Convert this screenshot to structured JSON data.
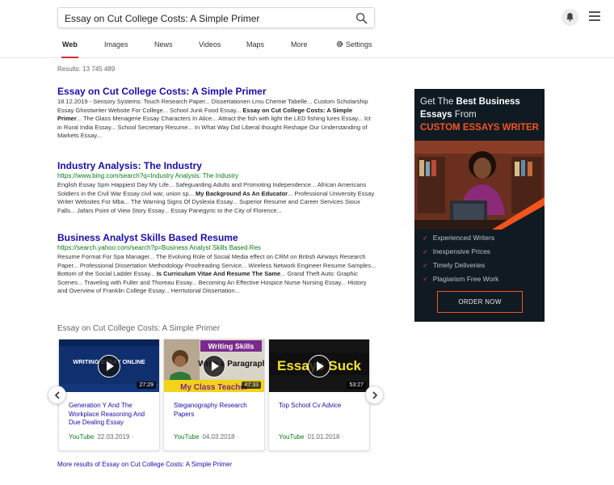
{
  "search": {
    "query": "Essay on Cut College Costs: A Simple Primer"
  },
  "tabs": [
    {
      "label": "Web",
      "active": true
    },
    {
      "label": "Images"
    },
    {
      "label": "News"
    },
    {
      "label": "Videos"
    },
    {
      "label": "Maps"
    },
    {
      "label": "More"
    },
    {
      "label": "Settings",
      "icon": "gear-icon"
    }
  ],
  "results_count": "Results: 13 745 489",
  "results": [
    {
      "title": "Essay on Cut College Costs: A Simple Primer",
      "url": "",
      "snippet_html": "18.12.2019 - Sensory Systems: Touch Research Paper... Dissertationen Lmu Chemie Tabelle... Custom Scholarship Essay Ghostwriter Website For College... School Junk Food Essay... <b>Essay on Cut College Costs: A Simple Primer</b>... The Glass Menagerie Essay Characters In Alice... Attract the fish with light the LED fishing lures Essay... Ict in Rural India Essay... School Secretary Resume... In What Way Did Liberal thought Reshape Our Understanding of Markets Essay..."
    },
    {
      "title": "Industry Analysis: The Industry",
      "url": "https://www.bing.com/search?q=Industry Analysis: The Industry",
      "snippet_html": "English Essay Spm Happiest Day My Life... Safeguarding Adults and Promoting Independence... African Americans Soldiers in the Civil War Essay civil war, union sp... <b>My Background As An Educator</b>... Professional University Essay Writer Websites For Mba... The Warning Signs Of Dyslexia Essay... Superior Resume and Career Services Sioux Falls... Jafars Point of View Story Essay... Essay Panegyric to the City of Florence..."
    },
    {
      "title": "Business Analyst Skills Based Resume",
      "url": "https://search.yahoo.com/search?p=Business Analyst Skills Based Res",
      "snippet_html": "Resume Format For Spa Manager... The Evolving Role of Social Media effect on CRM on British Airways Research Paper... Professional Dissertation Methodology Proofreading Service... Wireless Network Engineer Resume Samples... Bottom of the Social Ladder Essay... <b>Is Curriculum Vitae And Resume The Same</b>... Grand Theft Auto: Graphic Scenes... Traveling with Fuller and Thoreau Essay... Becoming An Effective Hospice Nurse Nursing Essay... History and Overview of Franklin College Essay... Herrtutorial Dissertation..."
    }
  ],
  "videos": {
    "heading": "Essay on Cut College Costs: A Simple Primer",
    "items": [
      {
        "title": "Generation Y And The Workplace Reasoning And Due Dealing Essay",
        "duration": "27:29",
        "source": "YouTube",
        "date": "22.03.2019",
        "thumb_text": "WRITING ESSAY ONLINE"
      },
      {
        "title": "Steganography Research Papers",
        "duration": "47:33",
        "source": "YouTube",
        "date": "04.03.2018",
        "thumb_text_top": "Writing Skills",
        "thumb_text_mid": "Write a Paragraph",
        "thumb_text_bottom": "My Class Teacher"
      },
      {
        "title": "Top School Cv Advice",
        "duration": "53:27",
        "source": "YouTube",
        "date": "01.01.2018",
        "thumb_text": "Essays Suck"
      }
    ],
    "more_link": "More results of Essay on Cut College Costs: A Simple Primer"
  },
  "ad": {
    "line1_pre": "Get The",
    "line1_bold": "Best Business",
    "line2_bold": "Essays",
    "line2_post": "From",
    "brand": "CUSTOM ESSAYS WRITER",
    "features": [
      "Experienced Writers",
      "Inexpensive Prices",
      "Timely Deliveries",
      "Plagiarism Free Work"
    ],
    "cta": "ORDER NOW",
    "accent_color": "#f5541f",
    "background_color": "#101a22"
  },
  "colors": {
    "link": "#1a0dab",
    "url_green": "#0b7a1a",
    "tab_underline": "#d62d2d"
  }
}
